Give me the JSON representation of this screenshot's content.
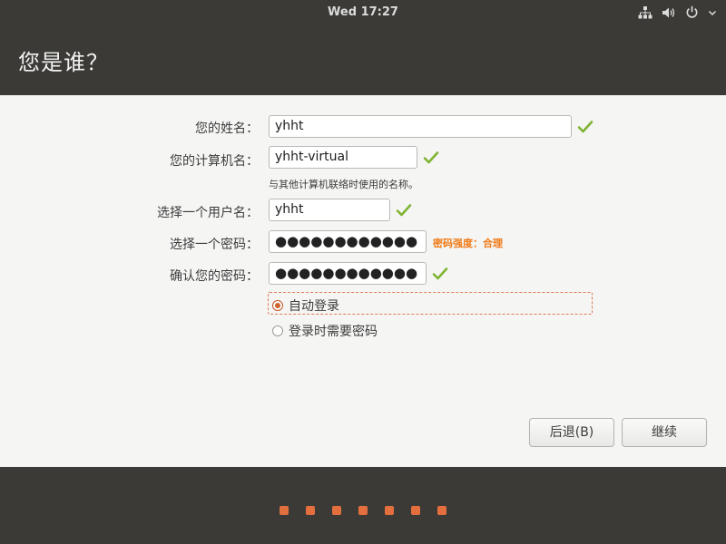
{
  "topbar": {
    "clock": "Wed 17:27",
    "icons": [
      "network-icon",
      "volume-icon",
      "power-icon",
      "chevron-down-icon"
    ]
  },
  "header": {
    "title": "您是谁？"
  },
  "form": {
    "name": {
      "label": "您的姓名：",
      "value": "yhht",
      "valid": true
    },
    "computer": {
      "label": "您的计算机名：",
      "value": "yhht-virtual",
      "valid": true,
      "hint": "与其他计算机联络时使用的名称。"
    },
    "username": {
      "label": "选择一个用户名：",
      "value": "yhht",
      "valid": true
    },
    "password": {
      "label": "选择一个密码：",
      "value": "●●●●●●●●●●●●",
      "strength": "密码强度：合理"
    },
    "confirm": {
      "label": "确认您的密码：",
      "value": "●●●●●●●●●●●●",
      "valid": true
    },
    "login_options": [
      {
        "label": "自动登录",
        "selected": true
      },
      {
        "label": "登录时需要密码",
        "selected": false
      }
    ]
  },
  "buttons": {
    "back": "后退(B)",
    "continue": "继续"
  },
  "progress": {
    "steps": 7
  },
  "colors": {
    "accent": "#e46f3e",
    "check": "#7fb431",
    "strength": "#f07a16",
    "bar": "#3b3a36"
  }
}
